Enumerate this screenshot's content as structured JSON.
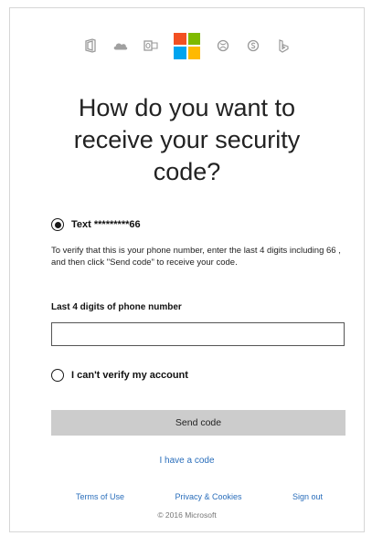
{
  "header": {
    "product_icons_left": [
      "office-icon",
      "onedrive-icon",
      "outlook-icon"
    ],
    "logo": "microsoft-logo",
    "product_icons_right": [
      "xbox-icon",
      "skype-icon",
      "bing-icon"
    ]
  },
  "title": "How do you want to receive your security code?",
  "options": {
    "text_label": "Text *********66",
    "text_selected": true,
    "cant_verify_label": "I can't verify my account",
    "cant_verify_selected": false
  },
  "description": "To verify that this is your phone number, enter the last 4 digits including 66 , and then click \"Send code\" to receive your code.",
  "digits_field": {
    "label": "Last 4 digits of phone number",
    "value": "",
    "placeholder": ""
  },
  "send_button_label": "Send code",
  "have_code_link": "I have a code",
  "footer": {
    "terms": "Terms of Use",
    "privacy": "Privacy & Cookies",
    "sign_out": "Sign out",
    "copyright": "© 2016 Microsoft"
  },
  "colors": {
    "link": "#2a6ebb",
    "button_bg": "#cccccc",
    "logo_red": "#f25022",
    "logo_green": "#7fba00",
    "logo_blue": "#00a4ef",
    "logo_yellow": "#ffb900"
  }
}
